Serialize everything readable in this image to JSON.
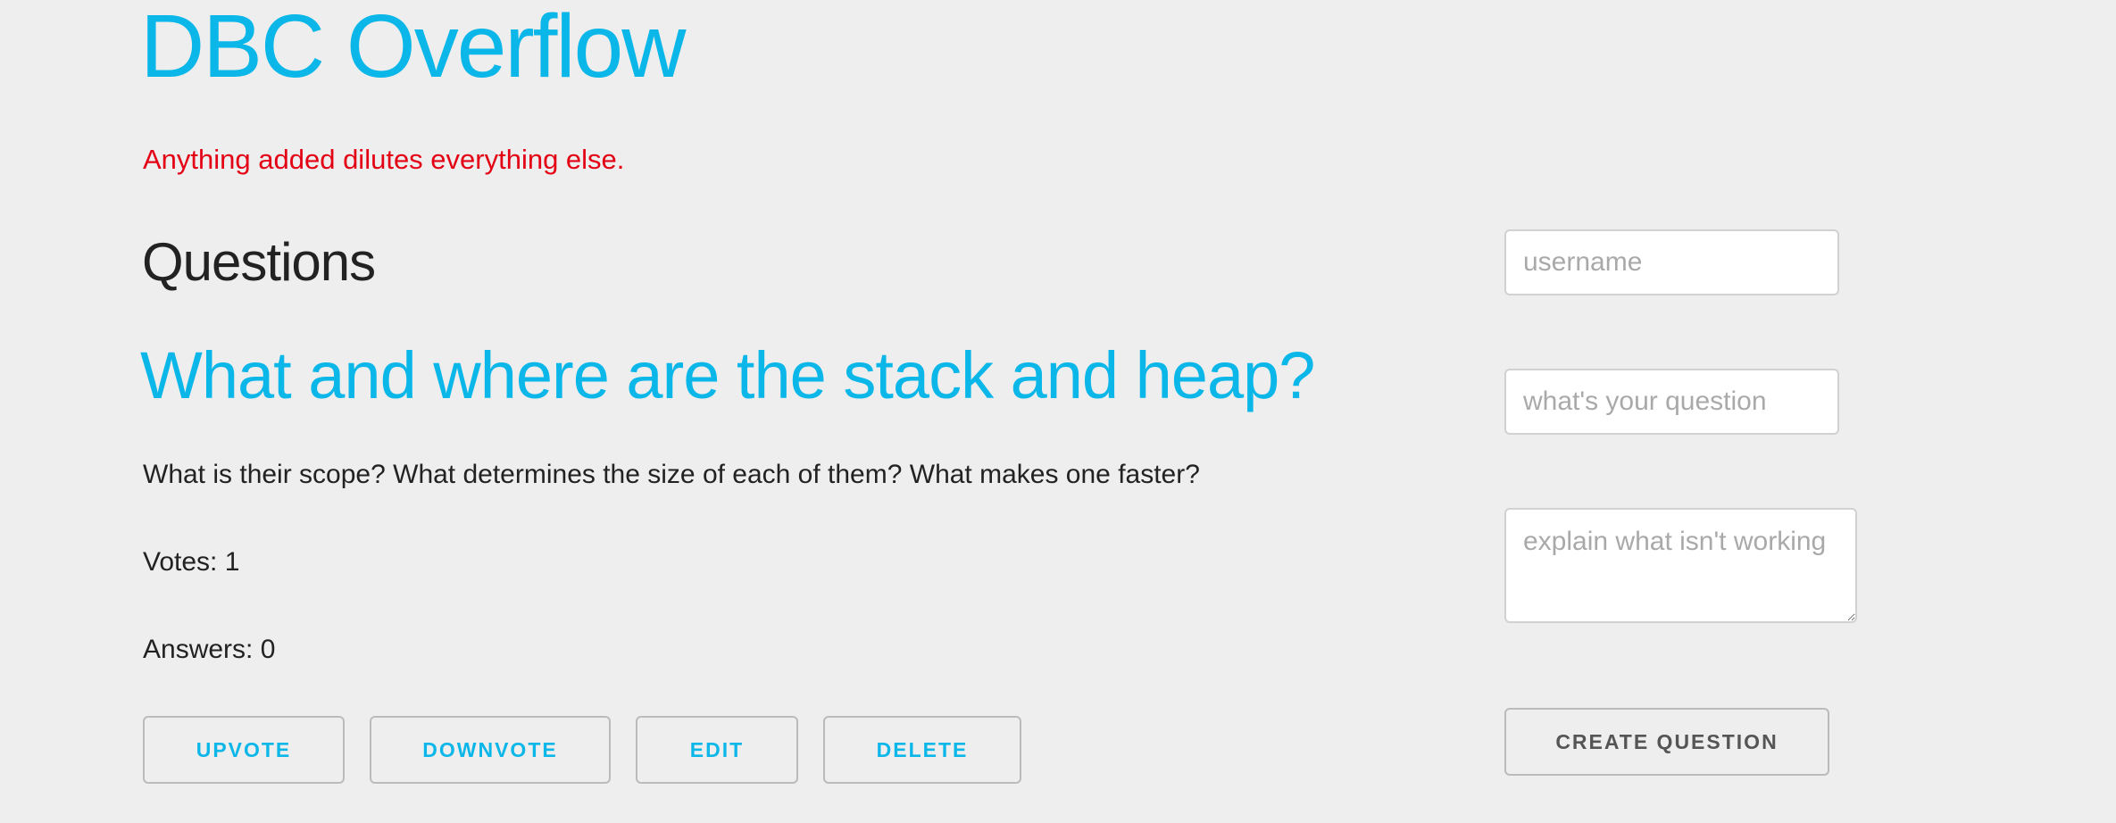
{
  "site": {
    "title": "DBC Overflow",
    "tagline": "Anything added dilutes everything else."
  },
  "questions": {
    "heading": "Questions",
    "items": [
      {
        "title": "What and where are the stack and heap?",
        "body": "What is their scope? What determines the size of each of them? What makes one faster?",
        "votes_label": "Votes: 1",
        "answers_label": "Answers: 0",
        "actions": {
          "upvote": "UPVOTE",
          "downvote": "DOWNVOTE",
          "edit": "EDIT",
          "delete": "DELETE"
        }
      }
    ]
  },
  "form": {
    "username_placeholder": "username",
    "question_placeholder": "what's your question",
    "explain_placeholder": "explain what isn't working",
    "submit_label": "CREATE QUESTION"
  },
  "colors": {
    "background": "#eeeeee",
    "accent": "#0ab7e8",
    "tagline": "#e40014",
    "text": "#222222",
    "button_border": "#bbbbbb"
  }
}
